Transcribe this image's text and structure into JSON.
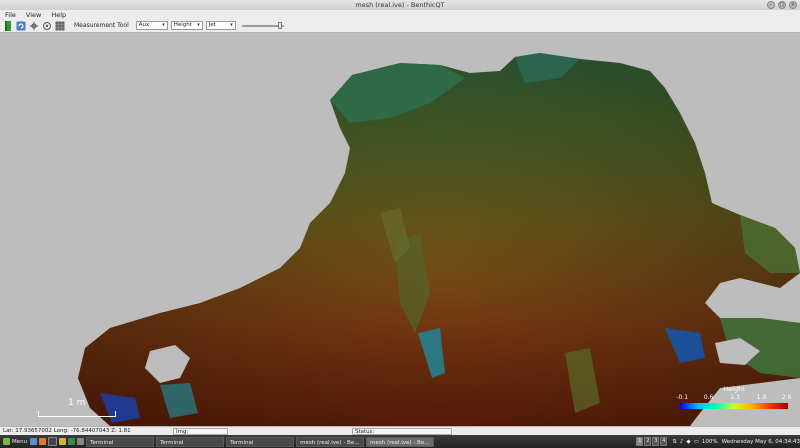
{
  "window": {
    "title": "mesh (real.ive) - BenthicQT"
  },
  "menu": {
    "items": [
      "File",
      "View",
      "Help"
    ]
  },
  "toolbar": {
    "measurement_label": "Measurement Tool",
    "select1": "Aux",
    "select2": "Height",
    "select3": "Jet",
    "slider_value": 0.95
  },
  "viewport": {
    "scale_label": "1 m",
    "legend": {
      "title": "Height",
      "ticks": [
        "-0.1",
        "0.6",
        "1.3",
        "1.9",
        "2.6"
      ],
      "colors": [
        "#0000ff",
        "#00c0ff",
        "#00ffb0",
        "#d0ff20",
        "#ffb000",
        "#ff3000",
        "#a00000"
      ]
    }
  },
  "statusbar": {
    "coords": "Lat: 17.93657002 Long: -76.84407043 Z: 1.81",
    "field1": "Img:",
    "field2": "Status:"
  },
  "taskbar": {
    "menu_label": "Menu",
    "windows": [
      "Terminal",
      "Terminal",
      "Terminal",
      "mesh (real.ive) - Be...",
      "mesh (real.ive) - Be..."
    ],
    "workspaces": [
      "1",
      "2",
      "3",
      "4"
    ],
    "battery": "100%",
    "clock": "Wednesday May 6, 04:34:43"
  }
}
